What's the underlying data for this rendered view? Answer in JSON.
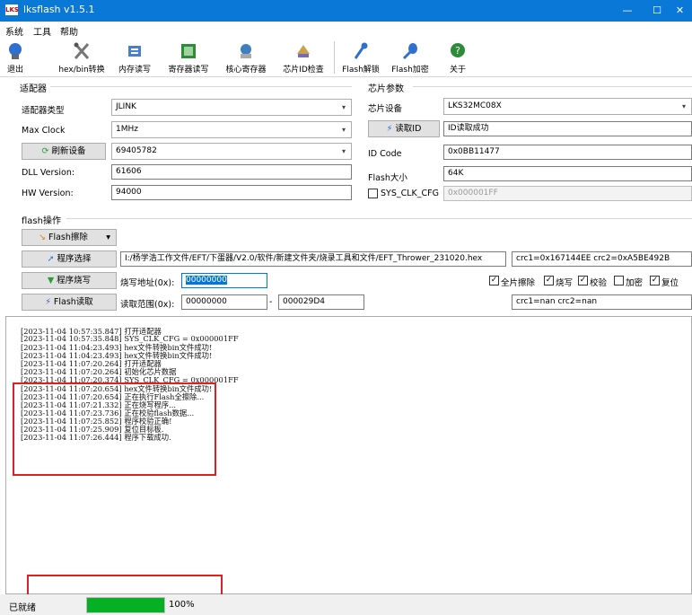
{
  "window": {
    "logo_text": "LKS",
    "title": "lksflash v1.5.1",
    "minimize_glyph": "—",
    "maximize_glyph": "☐",
    "close_glyph": "✕"
  },
  "menu": [
    "系统",
    "工具",
    "帮助"
  ],
  "toolbar": [
    {
      "label": "退出",
      "icon": "exit-icon"
    },
    {
      "label": "hex/bin转换",
      "icon": "tools-icon"
    },
    {
      "label": "内存读写",
      "icon": "memory-icon"
    },
    {
      "label": "寄存器读写",
      "icon": "register-icon"
    },
    {
      "label": "核心寄存器",
      "icon": "core-register-icon"
    },
    {
      "label": "芯片ID检查",
      "icon": "chip-id-icon"
    },
    {
      "label": "Flash解锁",
      "icon": "unlock-icon"
    },
    {
      "label": "Flash加密",
      "icon": "encrypt-icon"
    },
    {
      "label": "关于",
      "icon": "about-icon"
    }
  ],
  "adapter": {
    "heading": "适配器",
    "type_label": "适配器类型",
    "type_value": "JLINK",
    "clock_label": "Max Clock",
    "clock_value": "1MHz",
    "refresh_label": "刷新设备",
    "device_serial": "69405782",
    "dll_label": "DLL Version:",
    "dll_value": "61606",
    "hw_label": "HW Version:",
    "hw_value": "94000"
  },
  "chip": {
    "heading": "芯片参数",
    "device_label": "芯片设备",
    "device_value": "LKS32MC08X",
    "read_id_label": "读取ID",
    "read_id_status": "ID读取成功",
    "id_code_label": "ID Code",
    "id_code_value": "0x0BB11477",
    "flash_size_label": "Flash大小",
    "flash_size_value": "64K",
    "sys_clk_label": "SYS_CLK_CFG",
    "sys_clk_value": "0x000001FF"
  },
  "flash": {
    "heading": "flash操作",
    "erase_label": "Flash擦除",
    "select_program_label": "程序选择",
    "program_path": "I:/杨学浩工作文件/EFT/下蛋器/V2.0/软件/新建文件夹/烧录工具和文件/EFT_Thrower_231020.hex",
    "crc_program": "crc1=0x167144EE crc2=0xA5BE492B",
    "burn_label": "程序烧写",
    "burn_addr_label": "烧写地址(0x):",
    "burn_addr_value": "00000000",
    "options": [
      {
        "label": "全片擦除",
        "checked": true
      },
      {
        "label": "烧写",
        "checked": true
      },
      {
        "label": "校验",
        "checked": true
      },
      {
        "label": "加密",
        "checked": false
      },
      {
        "label": "复位",
        "checked": true
      }
    ],
    "read_label": "Flash读取",
    "read_range_label": "读取范围(0x):",
    "read_start": "00000000",
    "range_dash": "-",
    "read_end": "000029D4",
    "crc_read": "crc1=nan crc2=nan"
  },
  "log": [
    "[2023-11-04 10:57:35.847] 打开适配器",
    "[2023-11-04 10:57:35.848] SYS_CLK_CFG = 0x000001FF",
    "[2023-11-04 11:04:23.493] hex文件转换bin文件成功!",
    "[2023-11-04 11:04:23.493] hex文件转换bin文件成功!",
    "[2023-11-04 11:07:20.264] 打开适配器",
    "[2023-11-04 11:07:20.264] 初始化芯片数据",
    "[2023-11-04 11:07:20.374] SYS_CLK_CFG = 0x000001FF",
    "[2023-11-04 11:07:20.654] hex文件转换bin文件成功!",
    "[2023-11-04 11:07:20.654] 正在执行Flash全擦除...",
    "[2023-11-04 11:07:21.332] 正在烧写程序...",
    "[2023-11-04 11:07:23.736] 正在校验flash数据...",
    "[2023-11-04 11:07:25.852] 程序校验正确!",
    "[2023-11-04 11:07:25.909] 复位目标板.",
    "[2023-11-04 11:07:26.444] 程序下载成功."
  ],
  "status": {
    "text": "已就绪",
    "progress_percent": 100,
    "progress_label": "100%"
  },
  "colors": {
    "titlebar": "#0a78d7",
    "progress": "#06b025",
    "highlight": "#e02020"
  }
}
